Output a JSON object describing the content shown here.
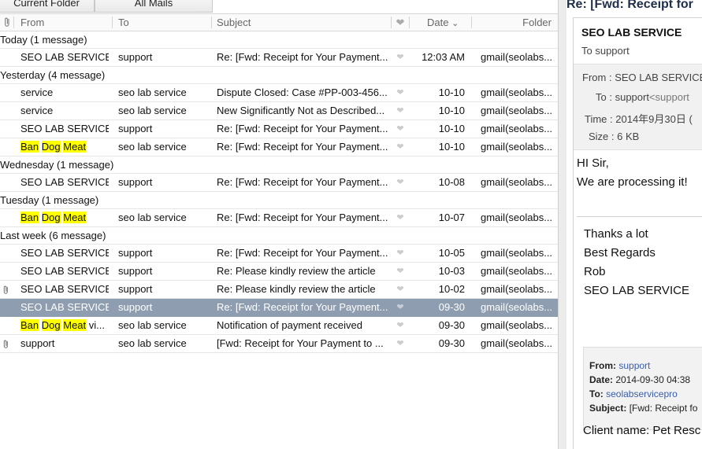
{
  "tabs": {
    "current_folder": "Current Folder",
    "all_mails": "All Mails"
  },
  "columns": {
    "from": "From",
    "to": "To",
    "subject": "Subject",
    "date": "Date",
    "folder": "Folder",
    "sort_indicator": "⌄"
  },
  "groups": [
    {
      "label": "Today (1 message)",
      "rows": [
        {
          "attach": false,
          "from": "SEO LAB SERVICE",
          "to": "support",
          "subject": "Re: [Fwd: Receipt for Your Payment...",
          "date": "12:03 AM",
          "folder": "gmail(seolabs...",
          "selected": false
        }
      ]
    },
    {
      "label": "Yesterday (4 message)",
      "rows": [
        {
          "attach": false,
          "from": "service",
          "to": "seo lab service",
          "subject": "Dispute Closed: Case #PP-003-456...",
          "date": "10-10",
          "folder": "gmail(seolabs...",
          "selected": false
        },
        {
          "attach": false,
          "from": "service",
          "to": "seo lab service",
          "subject": "New Significantly Not as Described...",
          "date": "10-10",
          "folder": "gmail(seolabs...",
          "selected": false
        },
        {
          "attach": false,
          "from": "SEO LAB SERVICE",
          "to": "support",
          "subject": "Re: [Fwd: Receipt for Your Payment...",
          "date": "10-10",
          "folder": "gmail(seolabs...",
          "selected": false
        },
        {
          "attach": false,
          "from_hl": [
            "Ban",
            "Dog",
            "Meat"
          ],
          "from_rest": "",
          "to": "seo lab service",
          "subject": "Re: [Fwd: Receipt for Your Payment...",
          "date": "10-10",
          "folder": "gmail(seolabs...",
          "selected": false
        }
      ]
    },
    {
      "label": "Wednesday (1 message)",
      "rows": [
        {
          "attach": false,
          "from": "SEO LAB SERVICE",
          "to": "support",
          "subject": "Re: [Fwd: Receipt for Your Payment...",
          "date": "10-08",
          "folder": "gmail(seolabs...",
          "selected": false
        }
      ]
    },
    {
      "label": "Tuesday (1 message)",
      "rows": [
        {
          "attach": false,
          "from_hl": [
            "Ban",
            "Dog",
            "Meat"
          ],
          "from_rest": "",
          "to": "seo lab service",
          "subject": "Re: [Fwd: Receipt for Your Payment...",
          "date": "10-07",
          "folder": "gmail(seolabs...",
          "selected": false
        }
      ]
    },
    {
      "label": "Last week (6 message)",
      "rows": [
        {
          "attach": false,
          "from": "SEO LAB SERVICE",
          "to": "support",
          "subject": "Re: [Fwd: Receipt for Your Payment...",
          "date": "10-05",
          "folder": "gmail(seolabs...",
          "selected": false
        },
        {
          "attach": false,
          "from": "SEO LAB SERVICE",
          "to": "support",
          "subject": "Re:  Please kindly review the article",
          "date": "10-03",
          "folder": "gmail(seolabs...",
          "selected": false
        },
        {
          "attach": true,
          "from": "SEO LAB SERVICE",
          "to": "support",
          "subject": "Re:  Please kindly review the article",
          "date": "10-02",
          "folder": "gmail(seolabs...",
          "selected": false
        },
        {
          "attach": false,
          "from": "SEO LAB SERVICE",
          "to": "support",
          "subject": "Re: [Fwd: Receipt for Your Payment...",
          "date": "09-30",
          "folder": "gmail(seolabs...",
          "selected": true
        },
        {
          "attach": false,
          "from_hl": [
            "Ban",
            "Dog",
            "Meat"
          ],
          "from_rest": " vi...",
          "to": "seo lab service",
          "subject": "Notification of payment received",
          "date": "09-30",
          "folder": "gmail(seolabs...",
          "selected": false
        },
        {
          "attach": true,
          "from": "support",
          "to": "seo lab service",
          "subject": "[Fwd: Receipt for Your Payment to ...",
          "date": "09-30",
          "folder": "gmail(seolabs...",
          "selected": false
        }
      ]
    }
  ],
  "preview": {
    "title": "Re: [Fwd: Receipt for",
    "subject": "SEO LAB SERVICE",
    "to_line": "To support",
    "meta": {
      "from_label": "From :",
      "from_value": "SEO LAB SERVICE",
      "to_label": "To :",
      "to_value": "support",
      "to_addr": "<support",
      "time_label": "Time :",
      "time_value": "2014年9月30日 (",
      "size_label": "Size :",
      "size_value": "6 KB"
    },
    "body": [
      "HI Sir,",
      "We are processing it!"
    ],
    "signature": [
      "Thanks a lot",
      "Best Regards",
      "Rob",
      "SEO LAB SERVICE"
    ],
    "quote": {
      "from_label": "From:",
      "from_value": "support",
      "date_label": "Date:",
      "date_value": "2014-09-30 04:38",
      "to_label": "To:",
      "to_value": "seolabservicepro",
      "subject_label": "Subject:",
      "subject_value": "[Fwd: Receipt fo"
    },
    "client_line": "Client name: Pet Resc"
  }
}
